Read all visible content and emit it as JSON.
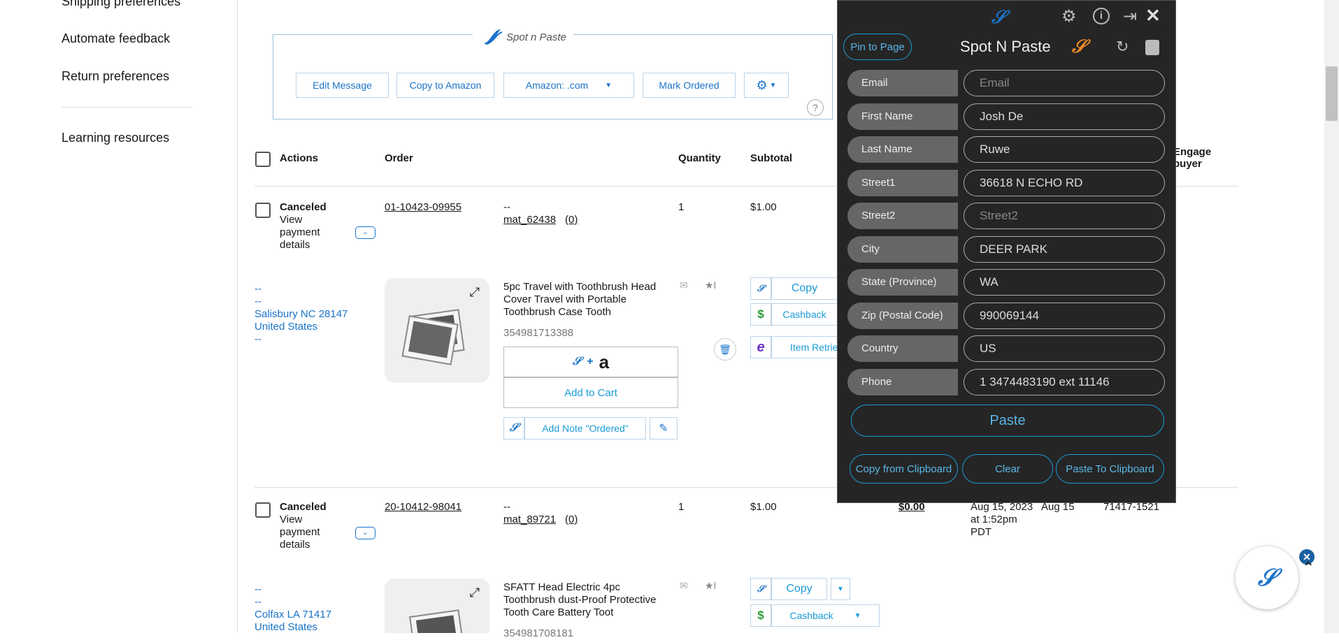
{
  "nav": {
    "items": [
      "Shipping preferences",
      "Automate feedback",
      "Return preferences",
      "Learning resources"
    ]
  },
  "toolbar": {
    "logo_text": "Spot n Paste",
    "edit_message": "Edit Message",
    "copy_to_amazon": "Copy to Amazon",
    "amazon_select": "Amazon: .com",
    "mark_ordered": "Mark Ordered",
    "help": "?"
  },
  "table": {
    "headers": {
      "actions": "Actions",
      "order": "Order",
      "quantity": "Quantity",
      "subtotal": "Subtotal",
      "engage": "Engage buyer"
    }
  },
  "orders": [
    {
      "status": "Canceled",
      "payment_link": "View payment details",
      "order_number": "01-10423-09955",
      "buyer_dash": "--",
      "buyer": "mat_62438",
      "feedback": "(0)",
      "quantity": "1",
      "subtotal": "$1.00",
      "address": [
        "--",
        "--",
        "Salisbury NC 28147",
        "United States",
        "--"
      ],
      "item_title": "5pc Travel with Toothbrush Head Cover Travel with Portable Toothbrush Case Tooth",
      "item_id": "354981713388",
      "add_to_cart": "Add to Cart",
      "add_note": "Add Note \"Ordered\"",
      "copy": "Copy",
      "cashback": "Cashback",
      "item_retrieve": "Item Retrieve"
    },
    {
      "status": "Canceled",
      "payment_link": "View payment details",
      "order_number": "20-10412-98041",
      "buyer_dash": "--",
      "buyer": "mat_89721",
      "feedback": "(0)",
      "quantity": "1",
      "subtotal": "$1.00",
      "total": "$0.00",
      "date": "Aug 15, 2023 at 1:52pm PDT",
      "ship_date": "Aug 15",
      "zip": "71417-1521",
      "address": [
        "--",
        "--",
        "Colfax LA 71417",
        "United States"
      ],
      "item_title": "SFATT Head Electric 4pc Toothbrush dust-Proof Protective Tooth Care Battery Toot",
      "item_id": "354981708181",
      "copy": "Copy",
      "cashback": "Cashback"
    }
  ],
  "panel": {
    "pin": "Pin to Page",
    "title": "Spot N Paste",
    "fields": [
      {
        "label": "Email",
        "value": "",
        "placeholder": "Email"
      },
      {
        "label": "First Name",
        "value": "Josh De",
        "placeholder": ""
      },
      {
        "label": "Last Name",
        "value": "Ruwe",
        "placeholder": ""
      },
      {
        "label": "Street1",
        "value": "36618 N ECHO RD",
        "placeholder": ""
      },
      {
        "label": "Street2",
        "value": "",
        "placeholder": "Street2"
      },
      {
        "label": "City",
        "value": "DEER PARK",
        "placeholder": ""
      },
      {
        "label": "State (Province)",
        "value": "WA",
        "placeholder": ""
      },
      {
        "label": "Zip (Postal Code)",
        "value": "990069144",
        "placeholder": ""
      },
      {
        "label": "Country",
        "value": "US",
        "placeholder": ""
      },
      {
        "label": "Phone",
        "value": "1 3474483190 ext 11146",
        "placeholder": ""
      }
    ],
    "paste": "Paste",
    "copy_from_clipboard": "Copy from Clipboard",
    "clear": "Clear",
    "paste_to_clipboard": "Paste To Clipboard"
  },
  "colors": {
    "accent": "#1a9bd7",
    "link": "#1a73c8",
    "panel_bg": "#252525"
  }
}
